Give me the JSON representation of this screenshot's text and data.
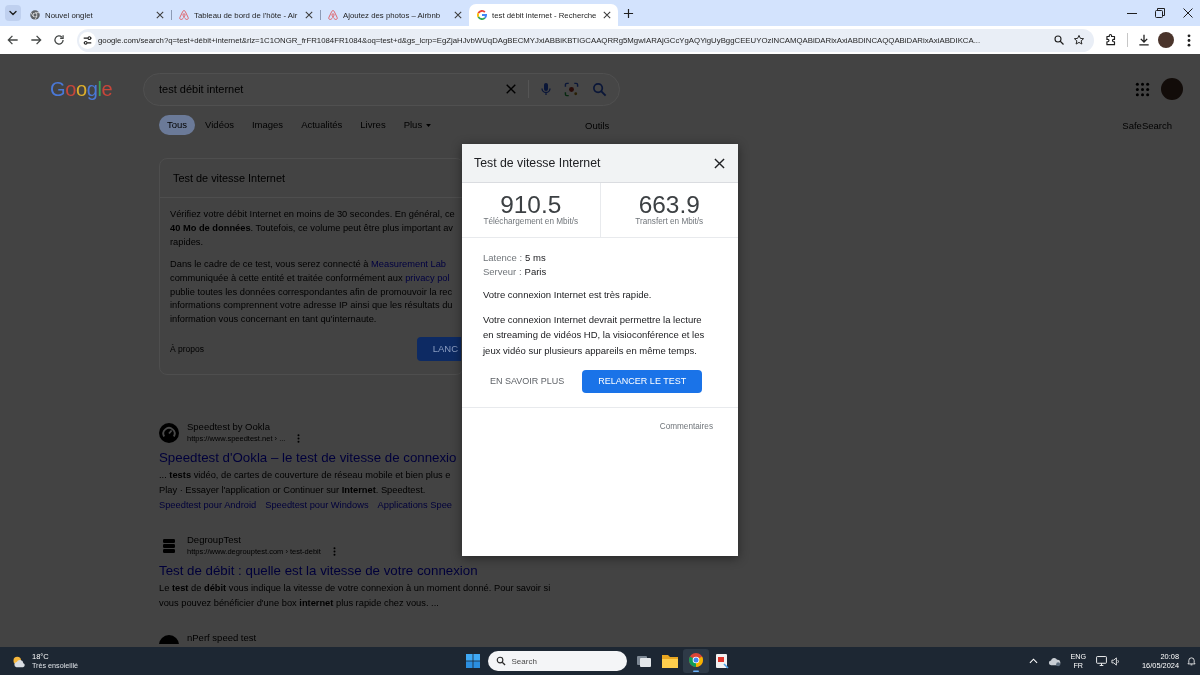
{
  "browser": {
    "tabs": [
      {
        "kind": "newtab",
        "title": "Nouvel onglet",
        "selected": false
      },
      {
        "kind": "airbnb",
        "title": "Tableau de bord de l'hôte - Air",
        "selected": false
      },
      {
        "kind": "airbnb",
        "title": "Ajoutez des photos – Airbnb",
        "selected": false
      },
      {
        "kind": "google",
        "title": "test débit internet - Recherche",
        "selected": true
      }
    ],
    "url": "google.com/search?q=test+débit+internet&rlz=1C1ONGR_frFR1084FR1084&oq=test+d&gs_lcrp=EgZjaHJvbWUqDAgBECMYJxiABBiKBTIGCAAQRRg5MgwIARAjGCcYgAQYigUyBggCEEUYOzINCAMQABiDARixAxiABDINCAQQABiDARixAxiABDIKCA..."
  },
  "search": {
    "logo": "Google",
    "query": "test débit internet",
    "nav": [
      {
        "kind": "link",
        "label": "Tous",
        "selected": true
      },
      {
        "kind": "link",
        "label": "Vidéos",
        "selected": false
      },
      {
        "kind": "link",
        "label": "Images",
        "selected": false
      },
      {
        "kind": "link",
        "label": "Actualités",
        "selected": false
      },
      {
        "kind": "link",
        "label": "Livres",
        "selected": false
      },
      {
        "kind": "menu",
        "label": "Plus",
        "selected": false
      }
    ],
    "tools": "Outils",
    "safesearch": "SafeSearch"
  },
  "speed_card": {
    "title": "Test de vitesse Internet",
    "paragraphs": [
      [
        {
          "text": "Vérifiez votre débit Internet en moins de 30 secondes. En général, ce"
        },
        {
          "text": "**40 Mo de données**. Toutefois, ce volume peut être plus important av"
        },
        {
          "text": "rapides."
        }
      ],
      [
        {
          "text": "Dans le cadre de ce test, vous serez connecté à",
          "link": "Measurement Lab"
        },
        {
          "text": "communiquée à cette entité et traitée conformément aux",
          "link": "privacy pol"
        },
        {
          "text": "publie toutes les données correspondantes afin de promouvoir la rec"
        },
        {
          "text": "informations comprennent votre adresse IP ainsi que les résultats du"
        },
        {
          "text": "information vous concernant en tant qu'internaute."
        }
      ]
    ],
    "about": "À propos",
    "button": "LANC"
  },
  "results": [
    {
      "kind": "gauge",
      "site": "Speedtest by Ookla",
      "url": "https://www.speedtest.net › ...",
      "title": "Speedtest d'Ookla – le test de vitesse de connexio",
      "snippet": [
        "... **tests** vidéo, de cartes de couverture de réseau mobile et bien plus e",
        "Play · Essayer l'application or Continuer sur **Internet**. Speedtest."
      ],
      "sitelinks": [
        "Speedtest pour Android",
        "Speedtest pour Windows",
        "Applications Spee"
      ]
    },
    {
      "kind": "stack",
      "site": "DegroupTest",
      "url": "https://www.degrouptest.com › test-debit",
      "title": "Test de débit : quelle est la vitesse de votre connexion",
      "snippet": [
        "Le **test** de **débit** vous indique la vitesse de votre connexion à un moment donné. Pour savoir si",
        "vous pouvez bénéficier d'une box **internet** plus rapide chez vous. ..."
      ]
    },
    {
      "kind": "disc",
      "site": "nPerf speed test"
    }
  ],
  "dialog": {
    "title": "Test de vitesse Internet",
    "stats": [
      {
        "value": "910.5",
        "label": "Téléchargement en Mbit/s"
      },
      {
        "value": "663.9",
        "label": "Transfert en Mbit/s"
      }
    ],
    "details": [
      {
        "label": "Latence :",
        "value": "5 ms"
      },
      {
        "label": "Serveur :",
        "value": "Paris"
      }
    ],
    "verdict": "Votre connexion Internet est très rapide.",
    "description": "Votre connexion Internet devrait permettre la lecture en streaming de vidéos HD, la visioconférence et les jeux vidéo sur plusieurs appareils en même temps.",
    "buttons": [
      {
        "kind": "text",
        "label": "EN SAVOIR PLUS"
      },
      {
        "kind": "filled",
        "label": "RELANCER LE TEST"
      }
    ],
    "feedback": "Commentaires"
  },
  "taskbar": {
    "weather": {
      "temperature": "18°C",
      "condition": "Très ensoleillé"
    },
    "search": {
      "placeholder": "Search"
    },
    "apps": [
      {
        "kind": "taskview",
        "selected": false
      },
      {
        "kind": "explorer",
        "selected": false
      },
      {
        "kind": "chrome",
        "selected": true
      },
      {
        "kind": "snip",
        "selected": false
      }
    ],
    "language": [
      "ENG",
      "FR"
    ],
    "time": "20:08",
    "date": "16/05/2024"
  }
}
